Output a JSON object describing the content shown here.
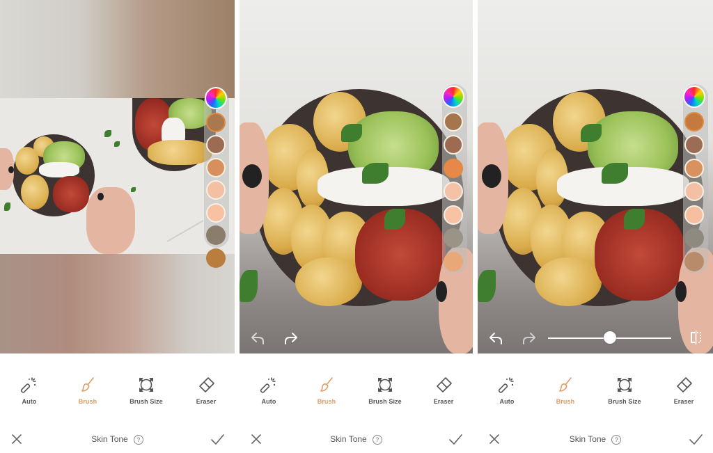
{
  "screens": [
    {
      "view": "zoomed-out",
      "toolbar": [
        {
          "label": "Auto",
          "icon": "magic-wand-icon",
          "active": false
        },
        {
          "label": "Brush",
          "icon": "brush-icon",
          "active": true
        },
        {
          "label": "Brush Size",
          "icon": "brush-size-icon",
          "active": false
        },
        {
          "label": "Eraser",
          "icon": "eraser-icon",
          "active": false
        }
      ],
      "footer": {
        "title": "Skin Tone",
        "help": "?",
        "cancel_icon": "close-icon",
        "confirm_icon": "checkmark-icon"
      },
      "swatches": [
        "color-wheel",
        "#a9784f",
        "#9b6b53",
        "#d88f5e",
        "#f3c0a3",
        "#f8c1a1",
        "#8a7d6b",
        "#b97d3d"
      ],
      "selected_swatch": 1,
      "undo_redo": false,
      "slider": null
    },
    {
      "view": "full",
      "toolbar": [
        {
          "label": "Auto",
          "icon": "magic-wand-icon",
          "active": false
        },
        {
          "label": "Brush",
          "icon": "brush-icon",
          "active": true
        },
        {
          "label": "Brush Size",
          "icon": "brush-size-icon",
          "active": false
        },
        {
          "label": "Eraser",
          "icon": "eraser-icon",
          "active": false
        }
      ],
      "footer": {
        "title": "Skin Tone",
        "help": "?",
        "cancel_icon": "close-icon",
        "confirm_icon": "checkmark-icon"
      },
      "swatches": [
        "color-wheel",
        "#a5764d",
        "#9c6b52",
        "#e8874a",
        "#f4c2a6",
        "#f8c3a4",
        "#9a9486",
        "#e8a878"
      ],
      "selected_swatch": 3,
      "undo_redo": true,
      "slider": null
    },
    {
      "view": "full",
      "toolbar": [
        {
          "label": "Auto",
          "icon": "magic-wand-icon",
          "active": false
        },
        {
          "label": "Brush",
          "icon": "brush-icon",
          "active": true
        },
        {
          "label": "Brush Size",
          "icon": "brush-size-icon",
          "active": false
        },
        {
          "label": "Eraser",
          "icon": "eraser-icon",
          "active": false
        }
      ],
      "footer": {
        "title": "Skin Tone",
        "help": "?",
        "cancel_icon": "close-icon",
        "confirm_icon": "checkmark-icon"
      },
      "swatches": [
        "color-wheel",
        "#c5793f",
        "#9b6d55",
        "#d9915f",
        "#f4c0a5",
        "#f6c0a0",
        "#8f8a7f",
        "#b88c6b"
      ],
      "selected_swatch": 1,
      "undo_redo": true,
      "slider": {
        "value": 0.5,
        "compare_icon": "compare-icon"
      }
    }
  ],
  "colors": {
    "accent": "#e39a63",
    "label": "#555555",
    "background": "#ffffff"
  }
}
